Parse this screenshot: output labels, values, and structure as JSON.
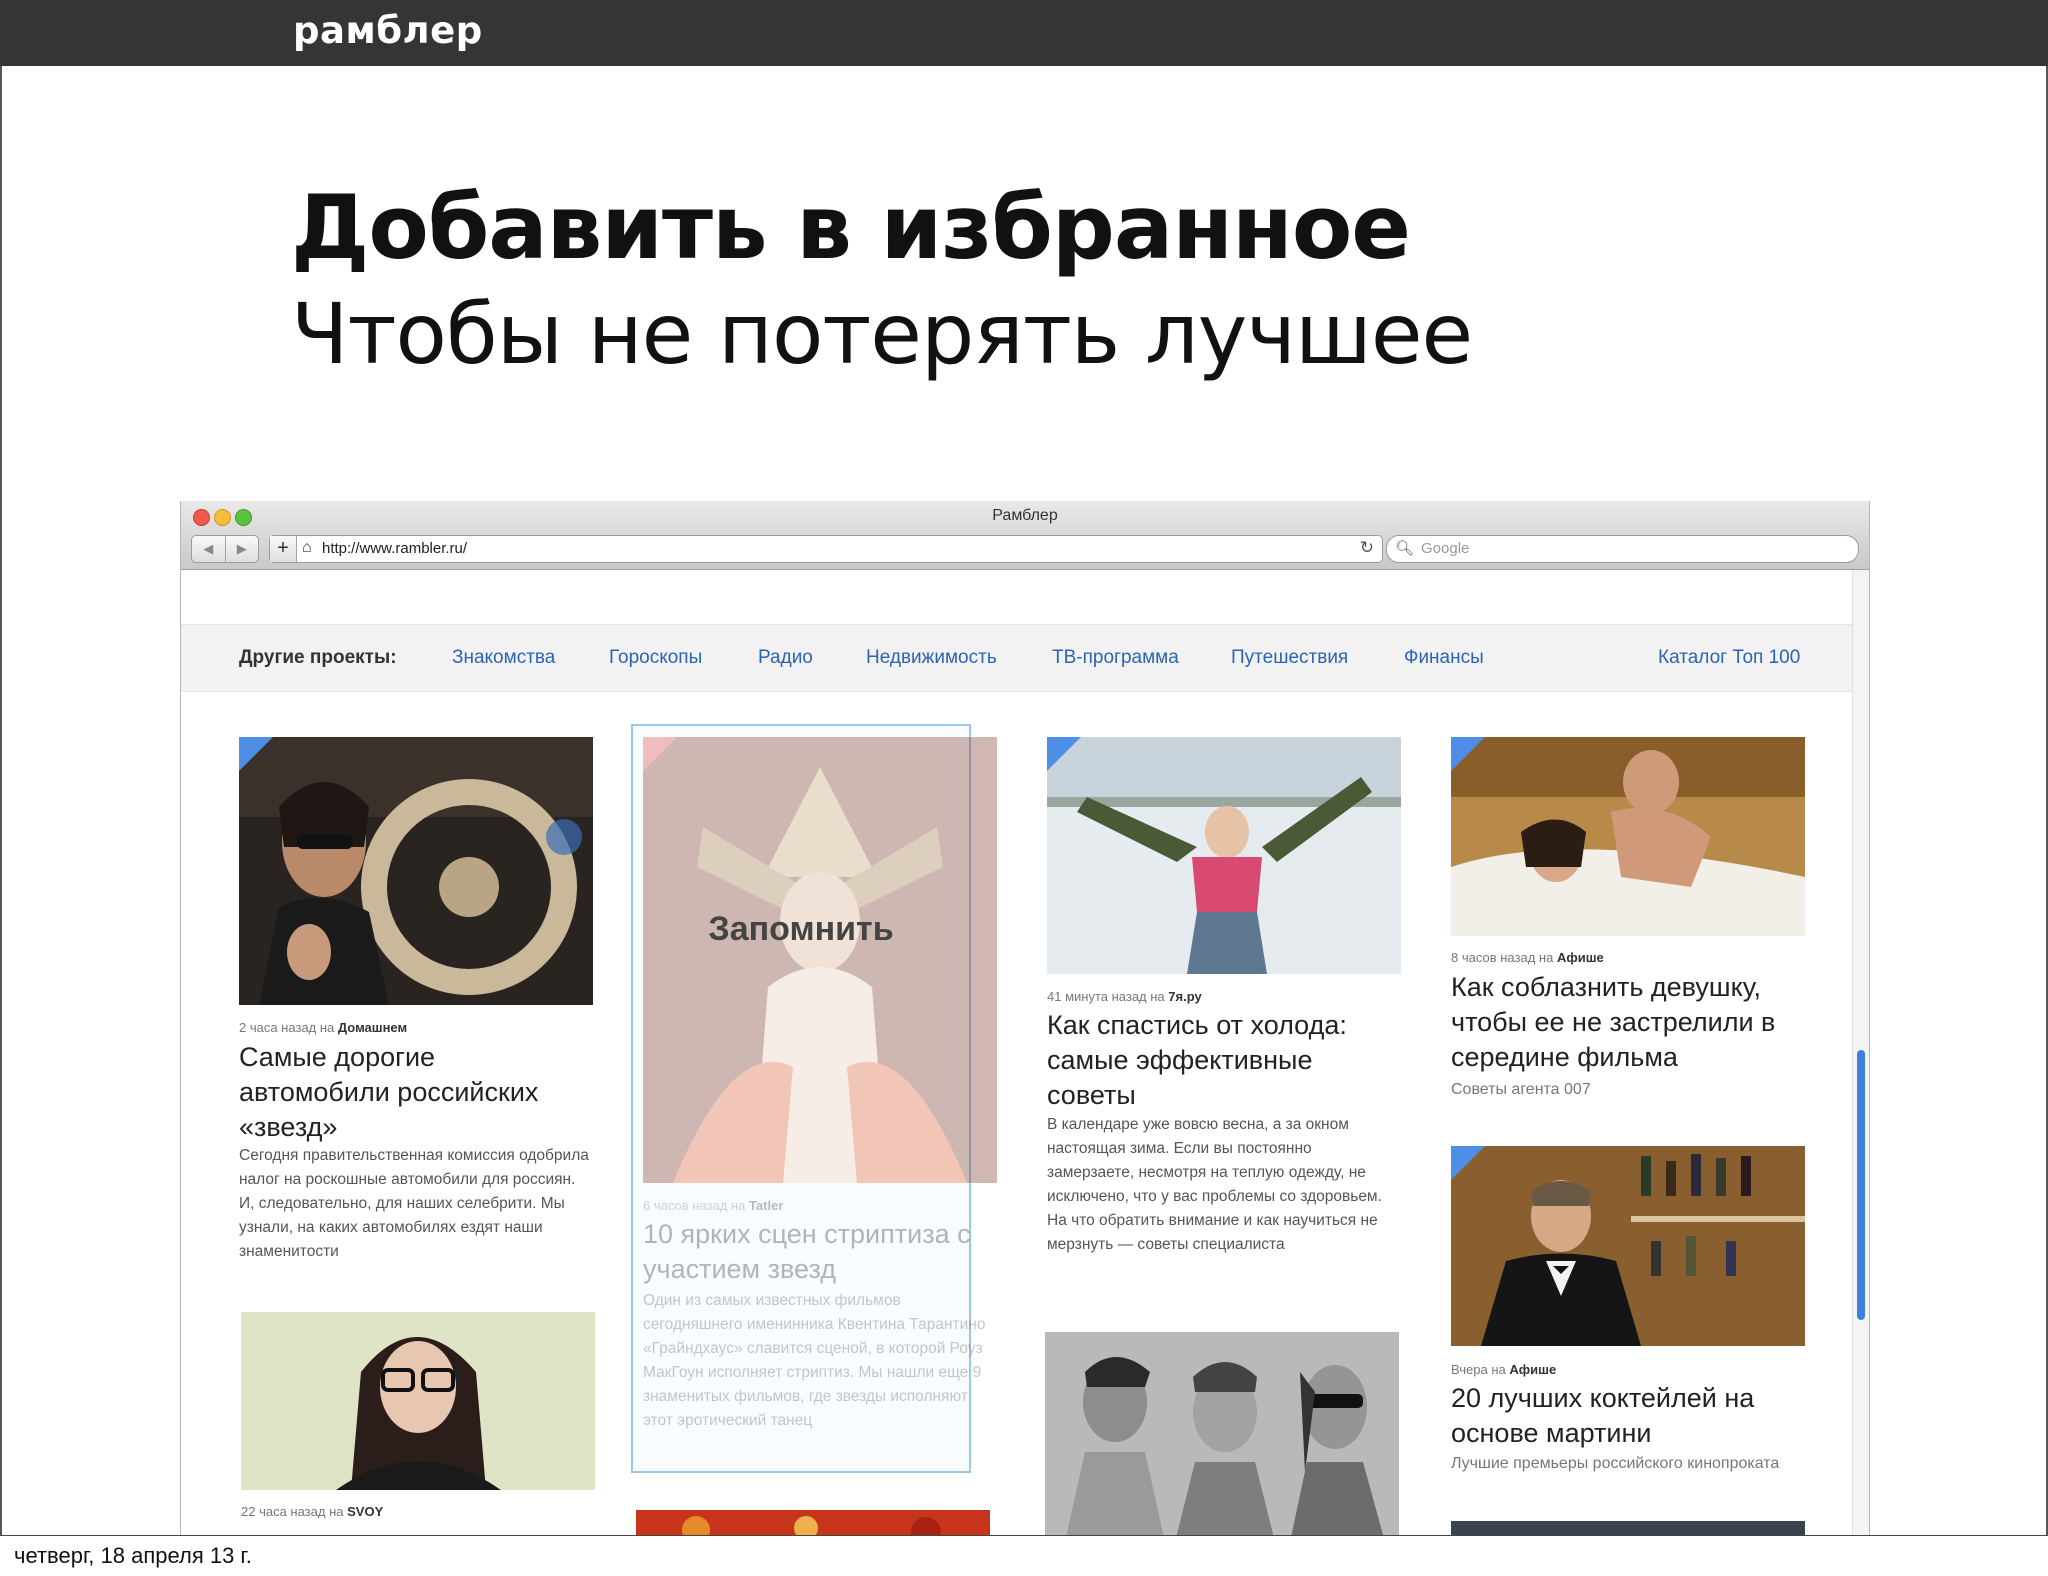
{
  "slide": {
    "brand": "рамблер",
    "title": "Добавить в избранное",
    "subtitle": "Чтобы не потерять лучшее",
    "footer_date": "четверг, 18 апреля 13 г."
  },
  "browser": {
    "window_title": "Рамблер",
    "url": "http://www.rambler.ru/",
    "search_placeholder": "Google"
  },
  "projects": {
    "label": "Другие проекты:",
    "links": [
      "Знакомства",
      "Гороскопы",
      "Радио",
      "Недвижимость",
      "ТВ-программа",
      "Путешествия",
      "Финансы"
    ],
    "catalog": "Каталог Топ 100"
  },
  "remember_label": "Запомнить",
  "cards": [
    {
      "meta_time": "2 часа назад на",
      "meta_source": "Домашнем",
      "title": "Самые дорогие автомобили российских «звезд»",
      "text": "Сегодня правительственная комиссия одобрила налог на роскошные автомобили для россиян. И, следовательно, для наших селебрити. Мы узнали, на каких автомобилях ездят наши знаменитости"
    },
    {
      "meta_time": "6 часов назад на",
      "meta_source": "Tatler",
      "title": "10 ярких сцен стриптиза с участием звезд",
      "text": "Один из самых известных фильмов сегодняшнего именинника Квентина Тарантино «Грайндхаус» славится сценой, в которой Роуз МакГоун исполняет стриптиз. Мы нашли еще 9 знаменитых фильмов, где звезды исполняют этот эротический танец"
    },
    {
      "meta_time": "41 минута назад на",
      "meta_source": "7я.ру",
      "title": "Как спастись от холода: самые эффективные советы",
      "text": "В календаре уже вовсю весна, а за окном настоящая зима. Если вы постоянно замерзаете, несмотря на теплую одежду, не исключено, что у вас проблемы со здоровьем. На что обратить внимание и как научиться не мерзнуть — советы специалиста"
    },
    {
      "meta_time": "8 часов назад на",
      "meta_source": "Афише",
      "title": "Как соблазнить девушку, чтобы ее не застрелили в середине фильма",
      "sub": "Советы агента 007"
    },
    {
      "meta_time": "Вчера на",
      "meta_source": "Афише",
      "title": "20 лучших коктейлей на основе мартини",
      "sub": "Лучшие премьеры российского кинопроката"
    },
    {
      "meta_time": "22 часа назад на",
      "meta_source": "SVOY"
    }
  ],
  "colors": {
    "link": "#2c64b5",
    "corner_blue": "#4f8ee6",
    "corner_red": "#e04040",
    "topbar": "#353535"
  }
}
